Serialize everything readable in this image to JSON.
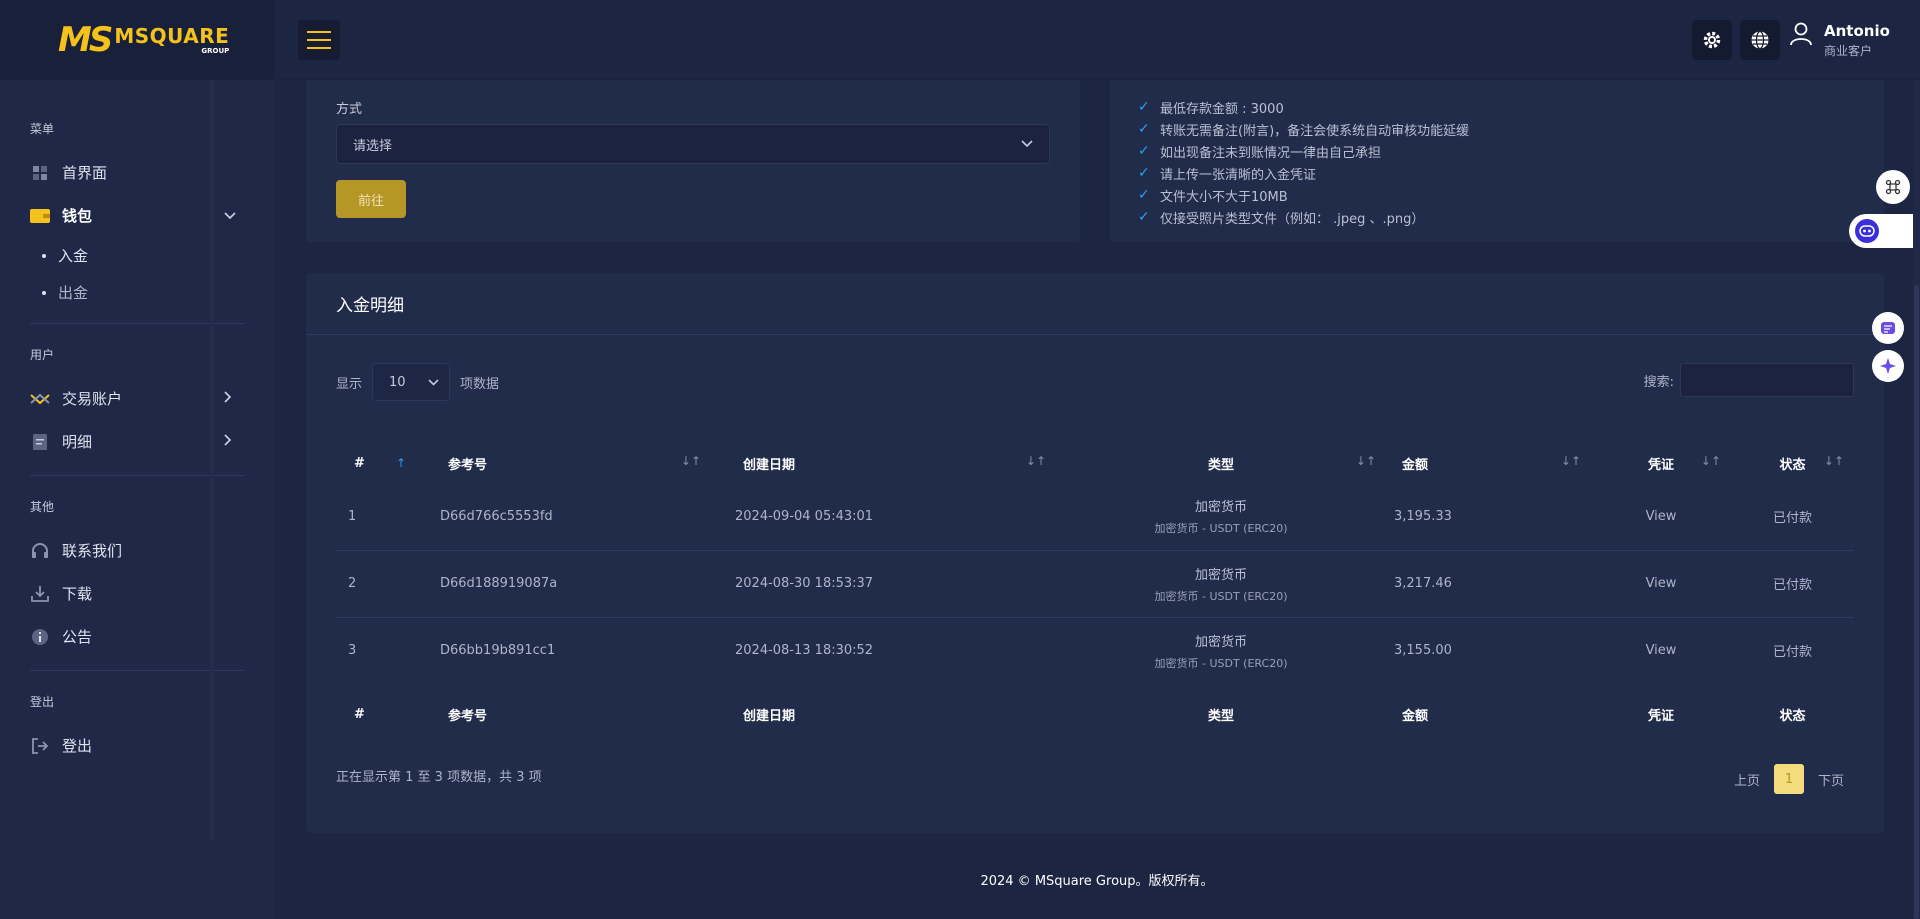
{
  "brand": {
    "logo_mark": "MS",
    "name": "MSQUARE",
    "tagline": "GROUP"
  },
  "colors": {
    "accent": "#f4c21a",
    "background": "#1c2541",
    "card": "#212b4a",
    "check": "#2aa2f0"
  },
  "header": {
    "menu_icon": "hamburger-icon",
    "settings_icon": "gear-icon",
    "language_icon": "globe-icon",
    "user": {
      "name": "Antonio",
      "role": "商业客户"
    }
  },
  "sidebar": {
    "section_menu": "菜单",
    "dashboard": "首界面",
    "wallet": "钱包",
    "wallet_sub": [
      "入金",
      "出金"
    ],
    "section_user": "用户",
    "trading_accounts": "交易账户",
    "details": "明细",
    "section_other": "其他",
    "contact": "联系我们",
    "download": "下载",
    "notice": "公告",
    "section_logout": "登出",
    "logout": "登出"
  },
  "deposit_form": {
    "method_label": "方式",
    "method_placeholder": "请选择",
    "submit_label": "前往"
  },
  "notes": [
    "最低存款金额 : 3000",
    "转账无需备注(附言)，备注会使系统自动审核功能延缓",
    "如出现备注未到账情况一律由自己承担",
    "请上传一张清晰的入金凭证",
    "文件大小不大于10MB",
    "仅接受照片类型文件（例如： .jpeg 、.png）"
  ],
  "table": {
    "title": "入金明细",
    "show_label": "显示",
    "page_length": "10",
    "entries_label": "项数据",
    "search_label": "搜索:",
    "columns": [
      "#",
      "参考号",
      "创建日期",
      "类型",
      "金额",
      "凭证",
      "状态"
    ],
    "rows": [
      {
        "num": "1",
        "ref": "D66d766c5553fd",
        "date": "2024-09-04 05:43:01",
        "type": "加密货币",
        "type_sub": "加密货币 - USDT (ERC20)",
        "amount": "3,195.33",
        "voucher": "View",
        "status": "已付款"
      },
      {
        "num": "2",
        "ref": "D66d188919087a",
        "date": "2024-08-30 18:53:37",
        "type": "加密货币",
        "type_sub": "加密货币 - USDT (ERC20)",
        "amount": "3,217.46",
        "voucher": "View",
        "status": "已付款"
      },
      {
        "num": "3",
        "ref": "D66bb19b891cc1",
        "date": "2024-08-13 18:30:52",
        "type": "加密货币",
        "type_sub": "加密货币 - USDT (ERC20)",
        "amount": "3,155.00",
        "voucher": "View",
        "status": "已付款"
      }
    ],
    "info": "正在显示第 1 至 3 项数据，共 3 项",
    "prev": "上页",
    "current_page": "1",
    "next": "下页"
  },
  "footer": "2024 © MSquare Group。版权所有。"
}
